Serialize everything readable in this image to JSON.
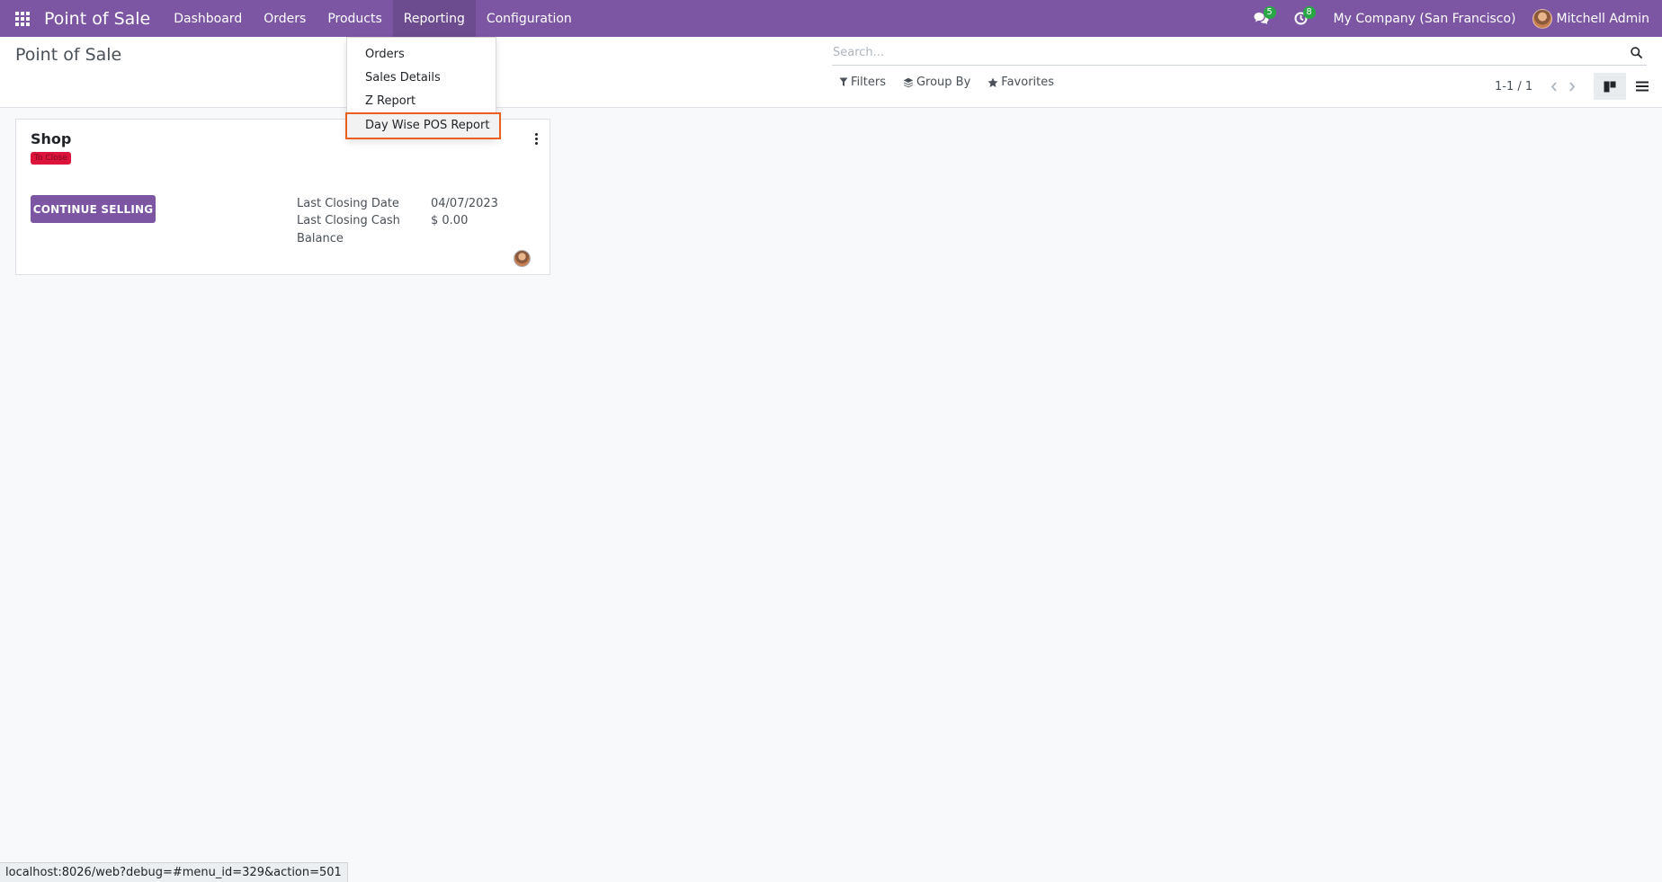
{
  "navbar": {
    "brand": "Point of Sale",
    "menu": [
      {
        "label": "Dashboard"
      },
      {
        "label": "Orders"
      },
      {
        "label": "Products"
      },
      {
        "label": "Reporting"
      },
      {
        "label": "Configuration"
      }
    ],
    "messages_count": "5",
    "activities_count": "8",
    "company": "My Company (San Francisco)",
    "user": "Mitchell Admin",
    "color": "#7c56a3"
  },
  "control_panel": {
    "title": "Point of Sale",
    "search_placeholder": "Search...",
    "filters_label": "Filters",
    "groupby_label": "Group By",
    "favorites_label": "Favorites",
    "pager_value": "1-1 / 1",
    "view_active": "kanban"
  },
  "reporting_dropdown": {
    "items": [
      {
        "label": "Orders"
      },
      {
        "label": "Sales Details"
      },
      {
        "label": "Z Report"
      },
      {
        "label": "Day Wise POS Report"
      }
    ],
    "highlighted_index": 3,
    "highlight_color": "#e8601c"
  },
  "card": {
    "title": "Shop",
    "tag": "To Close",
    "tag_color": "#dc143c",
    "button_label": "CONTINUE SELLING",
    "last_closing_date_label": "Last Closing Date",
    "last_closing_date_value": "04/07/2023",
    "last_closing_cash_label_1": "Last Closing Cash",
    "last_closing_cash_label_2": "Balance",
    "last_closing_cash_value": "$ 0.00"
  },
  "status_bar": {
    "url": "localhost:8026/web?debug=#menu_id=329&action=501"
  }
}
